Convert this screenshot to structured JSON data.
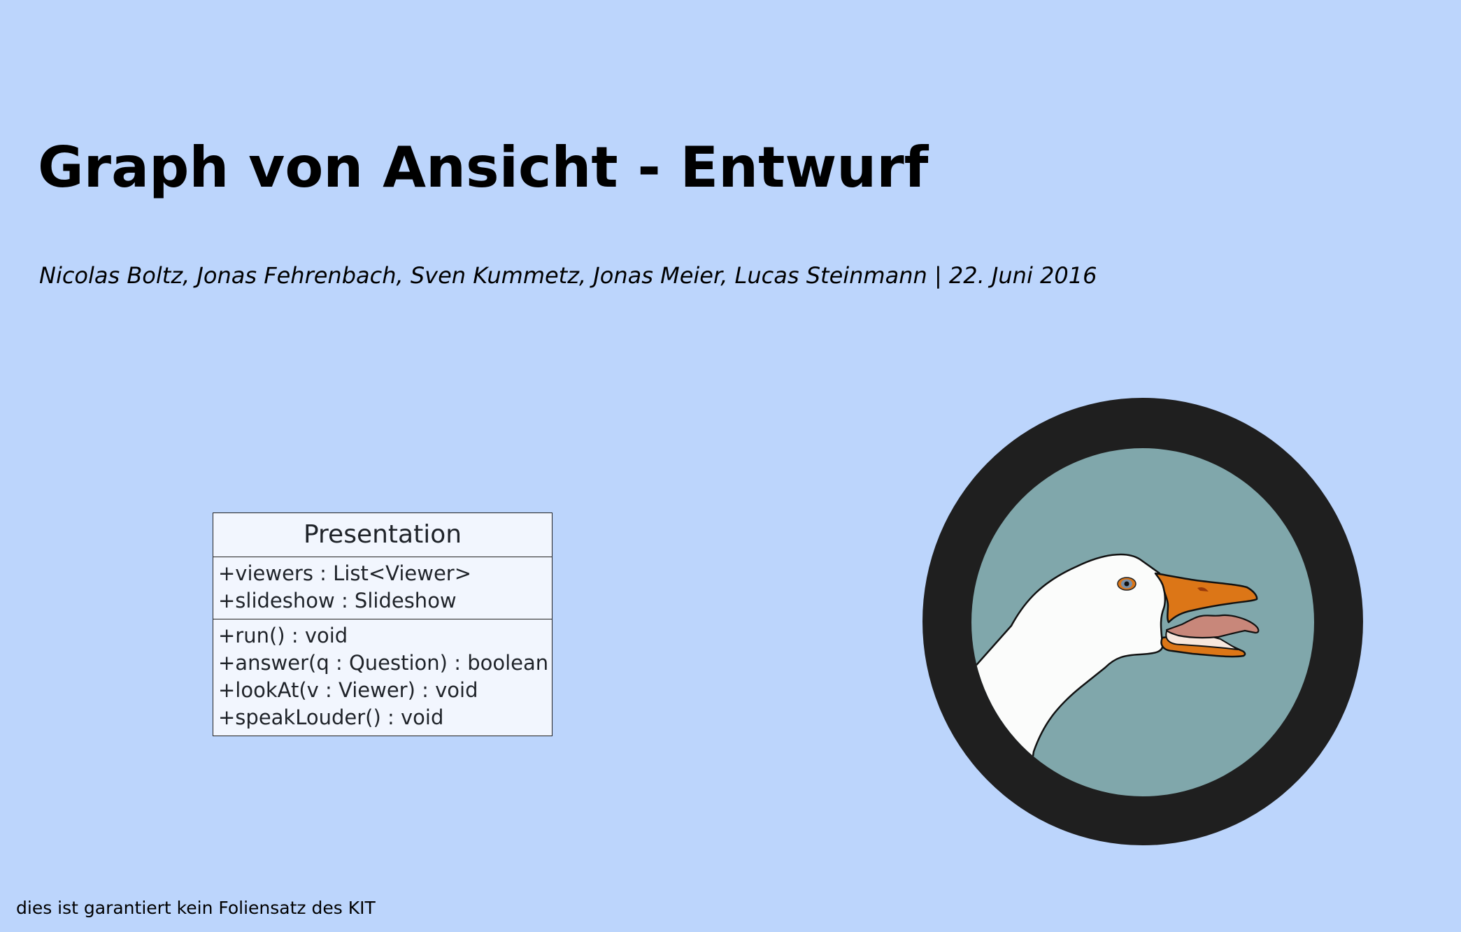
{
  "slide": {
    "title": "Graph von Ansicht - Entwurf",
    "subtitle": "Nicolas Boltz, Jonas Fehrenbach, Sven Kummetz, Jonas Meier, Lucas Steinmann | 22. Juni 2016",
    "footer": "dies ist garantiert kein Foliensatz des KIT"
  },
  "uml_class": {
    "name": "Presentation",
    "attributes": [
      "+viewers : List<Viewer>",
      "+slideshow : Slideshow"
    ],
    "methods": [
      "+run() : void",
      "+answer(q : Question) : boolean",
      "+lookAt(v : Viewer) : void",
      "+speakLouder() : void"
    ]
  },
  "logo": {
    "icon": "goose-head-icon",
    "ring_color": "#1f1f1f",
    "background_color": "#80a7ab",
    "beak_color": "#dc7617"
  },
  "colors": {
    "page_background": "#bcd5fc",
    "uml_box_fill": "#f2f6fe"
  }
}
